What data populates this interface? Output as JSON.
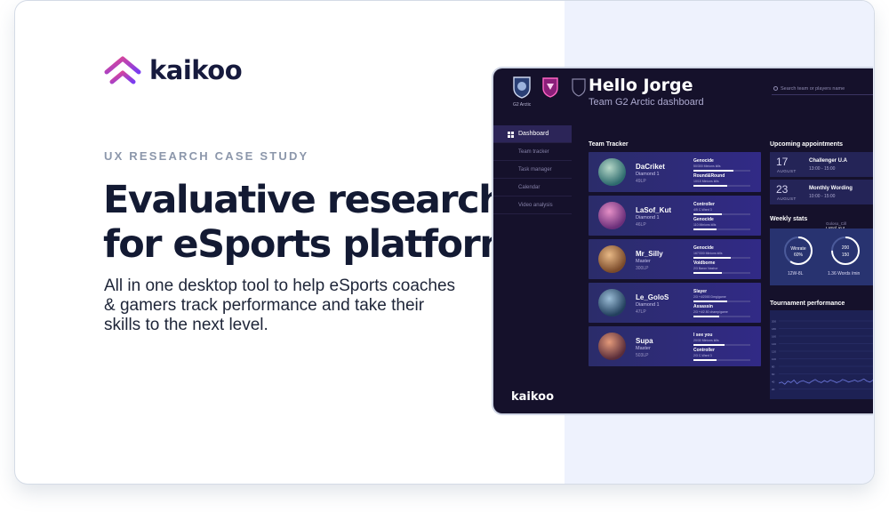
{
  "brand": {
    "name": "kaikoo",
    "accent_gradient": [
      "#7a3cf0",
      "#e8478b"
    ]
  },
  "hero": {
    "eyebrow": "UX RESEARCH CASE STUDY",
    "headline_line1": "Evaluative research",
    "headline_line2": "for eSports platform",
    "description": "All in one desktop tool to help eSports coaches & gamers track performance and take their skills to the next level."
  },
  "dashboard": {
    "team_caption": "G2 Arctic",
    "greeting": "Hello Jorge",
    "subtitle": "Team G2 Arctic dashboard",
    "search_placeholder": "Search team or players name",
    "nav": [
      {
        "label": "Dashboard",
        "active": true
      },
      {
        "label": "Team tracker"
      },
      {
        "label": "Task manager"
      },
      {
        "label": "Calendar"
      },
      {
        "label": "Video analysis"
      }
    ],
    "footer_brand": "kaikoo",
    "tracker_title": "Team Tracker",
    "players": [
      {
        "name": "DaCriket",
        "rank": "Diamond 1",
        "lp": "49LP",
        "stat1_title": "Genocide",
        "stat1_sub": "50/300 Minions kills",
        "stat1_fill": 0.7,
        "stat2_title": "Round&Round",
        "stat2_sub": "10/15 Minions kills",
        "stat2_fill": 0.6,
        "avatar": [
          "#2e6b6e",
          "#b6d8c8"
        ]
      },
      {
        "name": "LaSof_Kut",
        "rank": "Diamond 1",
        "lp": "46LP",
        "stat1_title": "Controller",
        "stat1_sub": "4/5 C-Ward 3",
        "stat1_fill": 0.5,
        "stat2_title": "Genocide",
        "stat2_sub": "110 Minions kills",
        "stat2_fill": 0.4,
        "avatar": [
          "#6b2f7a",
          "#e58fc6"
        ]
      },
      {
        "name": "Mr_Silly",
        "rank": "Master",
        "lp": "300LP",
        "stat1_title": "Genocide",
        "stat1_sub": "167/300 Minions kills",
        "stat1_fill": 0.65,
        "stat2_title": "Voidborne",
        "stat2_sub": "2/3 Baron Nashor",
        "stat2_fill": 0.5,
        "avatar": [
          "#7a4a2a",
          "#e8b986"
        ]
      },
      {
        "name": "Le_GoloS",
        "rank": "Diamond 1",
        "lp": "47LP",
        "stat1_title": "Slayer",
        "stat1_sub": "2/3 +4/2000 Dmg/game",
        "stat1_fill": 0.6,
        "stat2_title": "Assassin",
        "stat2_sub": "2/3 +4/2.50 champ/game",
        "stat2_fill": 0.45,
        "avatar": [
          "#23405e",
          "#9bbdd6"
        ]
      },
      {
        "name": "Supa",
        "rank": "Master",
        "lp": "503LP",
        "stat1_title": "I see you",
        "stat1_sub": "20/30 Minions kills",
        "stat1_fill": 0.55,
        "stat2_title": "Controller",
        "stat2_sub": "2/3 C-Ward 3",
        "stat2_fill": 0.4,
        "avatar": [
          "#5a2d3a",
          "#e49a7a"
        ]
      }
    ],
    "appointments_title": "Upcoming appointments",
    "appointments": [
      {
        "day": "17",
        "month": "AUGUST",
        "title": "Challenger U.A",
        "time": "13:00 - 15:00"
      },
      {
        "day": "23",
        "month": "AUGUST",
        "title": "Monthly Wording",
        "time": "10:00 - 15:00"
      }
    ],
    "weekly_title": "Weekly stats",
    "weekly_tabs": [
      "Goloso_Cill",
      "LaSof_Kut"
    ],
    "weekly": {
      "ring1_top": "Winrate",
      "ring1_bottom": "60%",
      "ring1_fill": 0.6,
      "ring1_caption": "12W-8L",
      "ring2_top": "200",
      "ring2_bottom": "150",
      "ring2_fill": 0.75,
      "ring2_caption": "1.36 Words /min"
    },
    "performance_title": "Tournament performance",
    "performance_y": [
      "200",
      "180",
      "160",
      "140",
      "120",
      "100",
      "80",
      "60",
      "40",
      "20"
    ],
    "performance_series": [
      20,
      22,
      18,
      24,
      21,
      26,
      19,
      23,
      25,
      22,
      20,
      24,
      27,
      23,
      21,
      25,
      22,
      26,
      24,
      21,
      23,
      27,
      25,
      22,
      24,
      26,
      23,
      25,
      28,
      24,
      22,
      26
    ]
  }
}
